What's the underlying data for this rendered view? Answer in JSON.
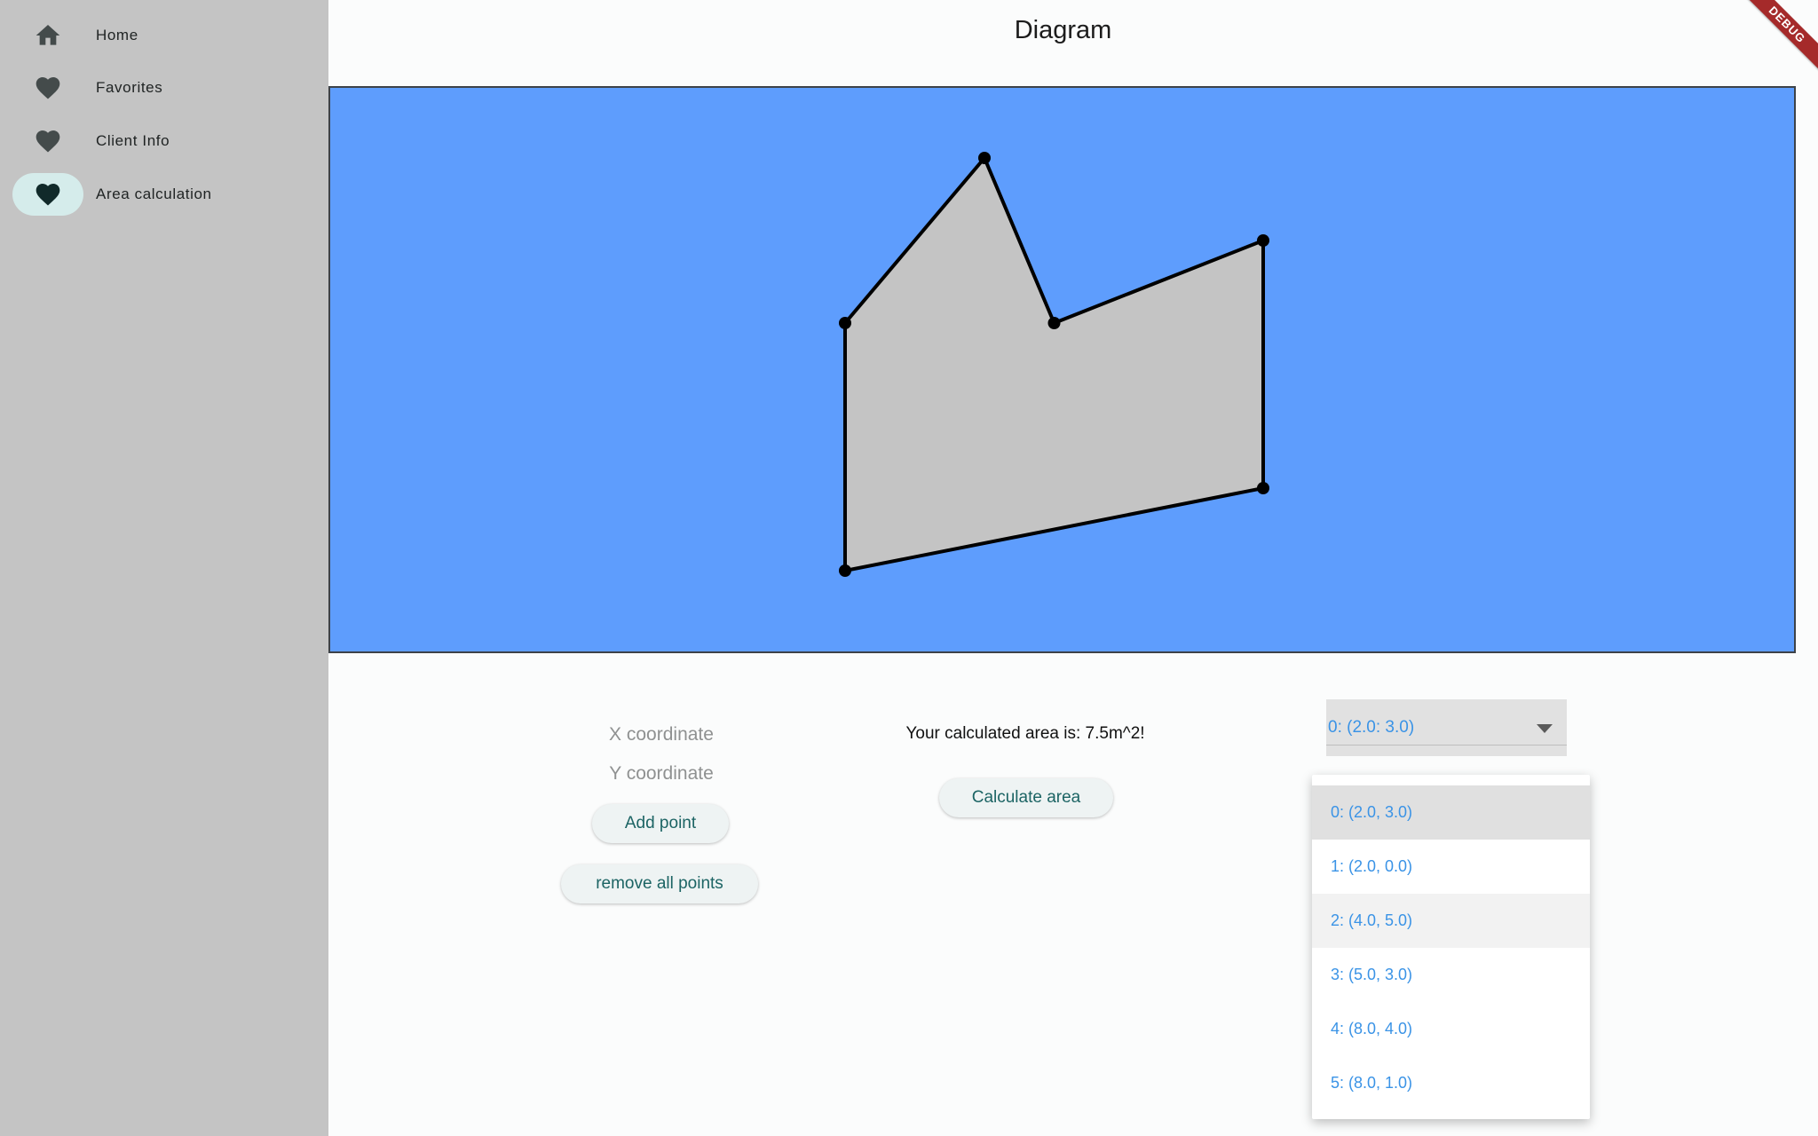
{
  "nav": {
    "items": [
      {
        "label": "Home",
        "icon": "home-icon"
      },
      {
        "label": "Favorites",
        "icon": "heart-icon"
      },
      {
        "label": "Client Info",
        "icon": "heart-icon"
      },
      {
        "label": "Area calculation",
        "icon": "heart-icon",
        "selected": true
      }
    ]
  },
  "page": {
    "title": "Diagram"
  },
  "diagram": {
    "background": "#5e9dfd",
    "polygon_fill": "#c4c4c4",
    "points": [
      [
        2.0,
        3.0
      ],
      [
        2.0,
        0.0
      ],
      [
        8.0,
        1.0
      ],
      [
        8.0,
        4.0
      ],
      [
        5.0,
        3.0
      ],
      [
        4.0,
        5.0
      ]
    ]
  },
  "form": {
    "x_placeholder": "X coordinate",
    "y_placeholder": "Y coordinate",
    "add_point_label": "Add point",
    "remove_all_label": "remove all points",
    "area_text": "Your calculated area is: 7.5m^2!",
    "calculate_label": "Calculate area"
  },
  "dropdown": {
    "selected": "0: (2.0: 3.0)",
    "options": [
      "0: (2.0, 3.0)",
      "1: (2.0, 0.0)",
      "2: (4.0, 5.0)",
      "3: (5.0, 3.0)",
      "4: (8.0, 4.0)",
      "5: (8.0, 1.0)"
    ]
  },
  "debug_banner": "DEBUG",
  "colors": {
    "accent": "#1c6464",
    "dropdown_text": "#3a93e6",
    "sidebar": "#c4c4c4"
  }
}
